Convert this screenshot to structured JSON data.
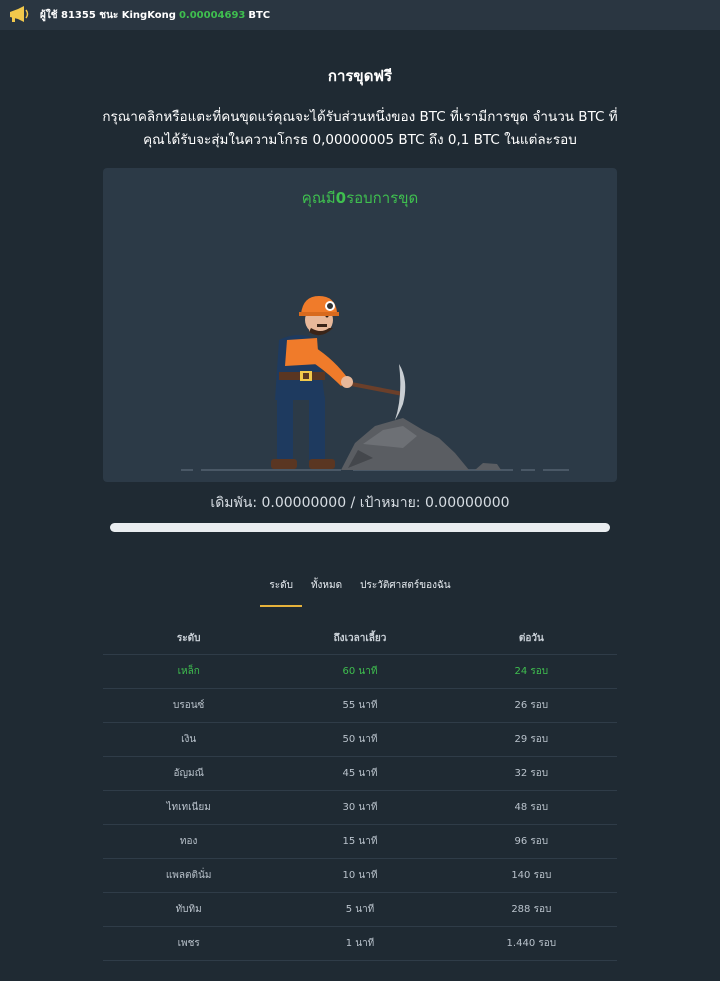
{
  "topbar": {
    "prefix": "ผู้ใช้ 81355 ชนะ KingKong",
    "amount": "0.00004693",
    "currency": "BTC",
    "icon": "megaphone-icon"
  },
  "header": {
    "title": "การขุดฟรี",
    "description": "กรุณาคลิกหรือแตะที่คนขุดแร่คุณจะได้รับส่วนหนึ่งของ BTC ที่เรามีการขุด จำนวน BTC ที่คุณได้รับจะสุ่มในความโกรธ 0,00000005 BTC ถึง 0,1 BTC ในแต่ละรอบ"
  },
  "mining": {
    "rounds_prefix": "คุณมี",
    "rounds_count": "0",
    "rounds_suffix": "รอบการขุด",
    "bet_line": "เดิมพัน: 0.00000000 / เป้าหมาย: 0.00000000",
    "progress": 0
  },
  "tabs": [
    {
      "label": "ระดับ",
      "active": true
    },
    {
      "label": "ทั้งหมด",
      "active": false
    },
    {
      "label": "ประวัติศาสตร์ของฉัน",
      "active": false
    }
  ],
  "table": {
    "headers": [
      "ระดับ",
      "ถึงเวลาเลี้ยว",
      "ต่อวัน"
    ],
    "rows": [
      [
        "เหล็ก",
        "60 นาที",
        "24 รอบ"
      ],
      [
        "บรอนซ์",
        "55 นาที",
        "26 รอบ"
      ],
      [
        "เงิน",
        "50 นาที",
        "29 รอบ"
      ],
      [
        "อัญมณี",
        "45 นาที",
        "32 รอบ"
      ],
      [
        "ไทเทเนียม",
        "30 นาที",
        "48 รอบ"
      ],
      [
        "ทอง",
        "15 นาที",
        "96 รอบ"
      ],
      [
        "แพลตตินั่ม",
        "10 นาที",
        "140 รอบ"
      ],
      [
        "ทับทิม",
        "5 นาที",
        "288 รอบ"
      ],
      [
        "เพชร",
        "1 นาที",
        "1.440 รอบ"
      ]
    ]
  },
  "colors": {
    "accent_green": "#3fbf4f",
    "tab_underline": "#e6b23b",
    "background": "#1f2a33"
  }
}
